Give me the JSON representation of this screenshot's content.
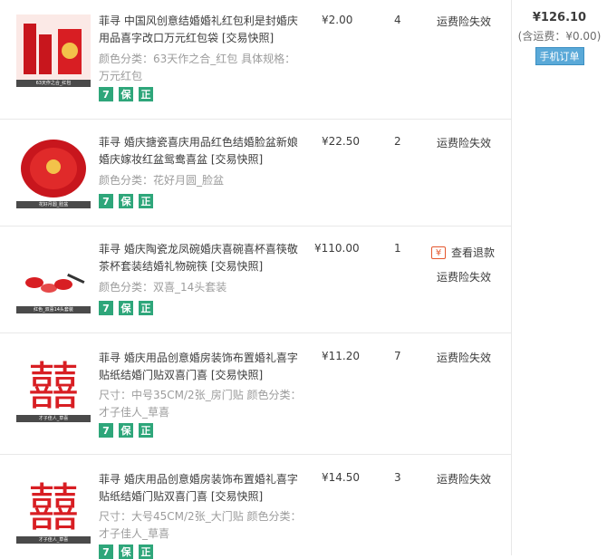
{
  "orders": [
    {
      "title": "菲寻 中国风创意结婚婚礼红包利是封婚庆用品喜字改口万元红包袋",
      "snapshot": "[交易快照]",
      "props_label": "颜色分类：",
      "props_value": "63天作之合_红包  具体规格：万元红包",
      "thumb_caption": "63天作之合_红包",
      "price": "¥2.00",
      "qty": "4",
      "status": "运费险失效",
      "badges": [
        "7",
        "保",
        "正"
      ]
    },
    {
      "title": "菲寻 婚庆搪瓷喜庆用品红色结婚脸盆新娘婚庆嫁妆红盆鸳鸯喜盆",
      "snapshot": "[交易快照]",
      "props_label": "颜色分类：",
      "props_value": "花好月圆_脸盆",
      "thumb_caption": "花好月圆_脸盆",
      "price": "¥22.50",
      "qty": "2",
      "status": "运费险失效",
      "badges": [
        "7",
        "保",
        "正"
      ]
    },
    {
      "title": "菲寻 婚庆陶瓷龙凤碗婚庆喜碗喜杯喜筷敬茶杯套装结婚礼物碗筷",
      "snapshot": "[交易快照]",
      "props_label": "颜色分类：",
      "props_value": "双喜_14头套装",
      "thumb_caption": "红色_双喜14头套装",
      "price": "¥110.00",
      "qty": "1",
      "refund": "查看退款",
      "status": "运费险失效",
      "badges": [
        "7",
        "保",
        "正"
      ]
    },
    {
      "title": "菲寻 婚庆用品创意婚房装饰布置婚礼喜字贴纸结婚门贴双喜门喜",
      "snapshot": "[交易快照]",
      "props_label": "尺寸：",
      "props_value": "中号35CM/2张_房门贴  颜色分类：才子佳人_草喜",
      "thumb_caption": "才子佳人_草喜",
      "price": "¥11.20",
      "qty": "7",
      "status": "运费险失效",
      "badges": [
        "7",
        "保",
        "正"
      ]
    },
    {
      "title": "菲寻 婚庆用品创意婚房装饰布置婚礼喜字贴纸结婚门贴双喜门喜",
      "snapshot": "[交易快照]",
      "props_label": "尺寸：",
      "props_value": "大号45CM/2张_大门贴  颜色分类：才子佳人_草喜",
      "thumb_caption": "才子佳人_草喜",
      "price": "¥14.50",
      "qty": "3",
      "status": "运费险失效",
      "badges": [
        "7",
        "保",
        "正"
      ]
    }
  ],
  "summary": {
    "total": "¥126.10",
    "shipping": "(含运费：¥0.00)",
    "mobile_order": "手机订单"
  },
  "colors": {
    "badge": "#2ea67a",
    "refund_icon": "#e4572e",
    "mobile_btn": "#5aa9d8"
  },
  "icons": {
    "refund": "yen-icon"
  }
}
